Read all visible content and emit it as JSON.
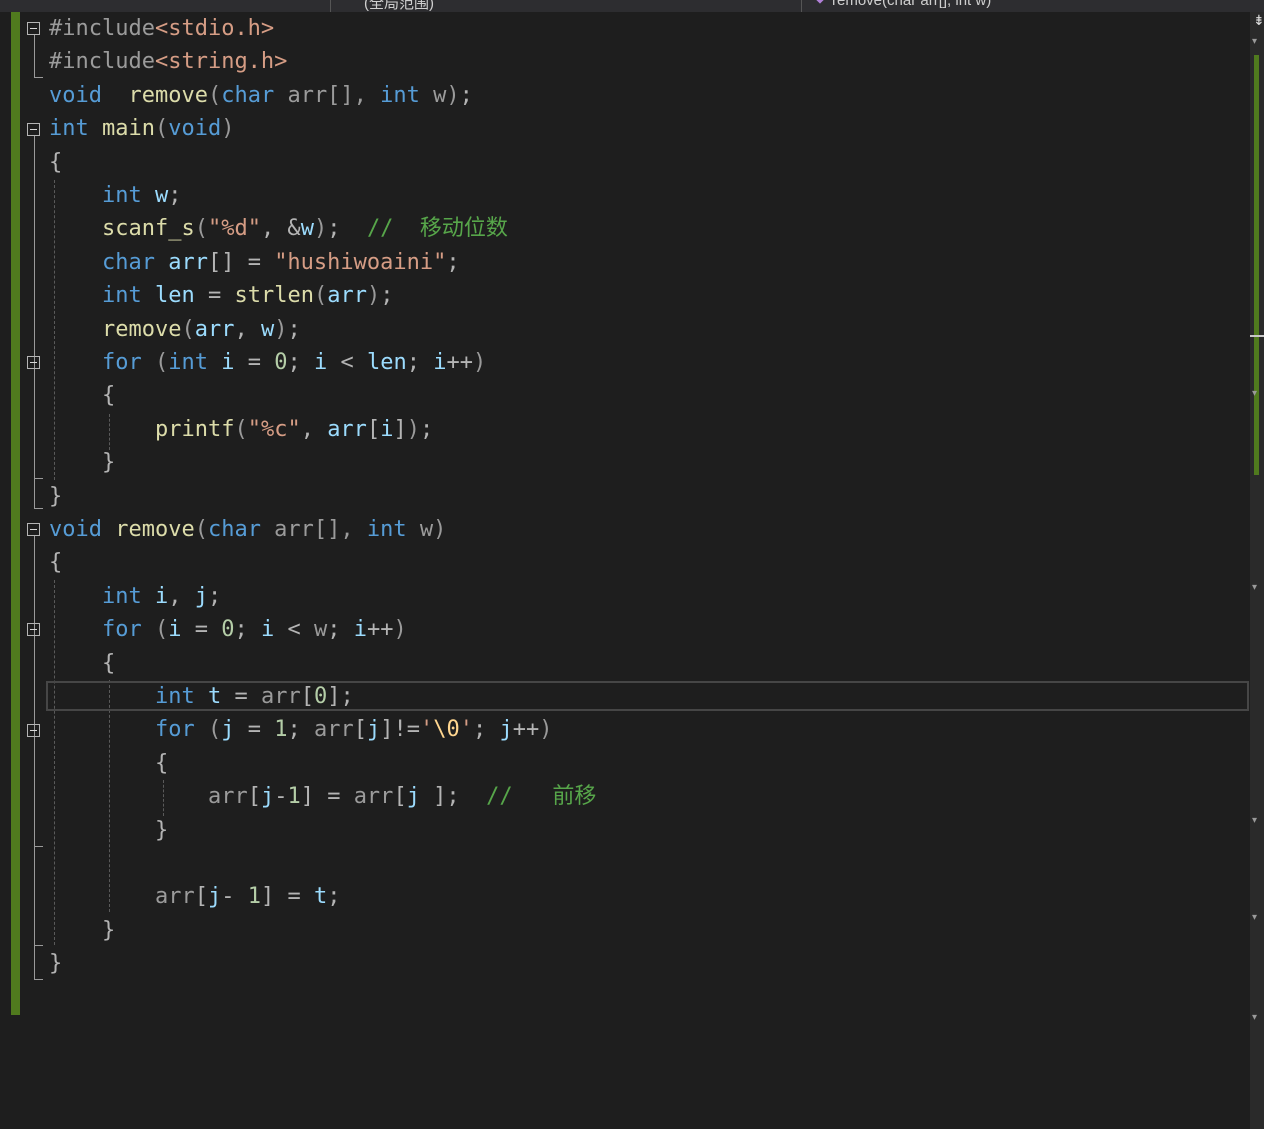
{
  "navbar": {
    "project_scope": "",
    "global_scope": "(全局范围)",
    "member": "remove(char arr[], int w)"
  },
  "lines": [
    [
      [
        "pp",
        "#include"
      ],
      [
        "str",
        "<stdio.h>"
      ]
    ],
    [
      [
        "pp",
        "#include"
      ],
      [
        "str",
        "<string.h>"
      ]
    ],
    [
      [
        "kw",
        "void"
      ],
      [
        "",
        "  "
      ],
      [
        "fn",
        "remove"
      ],
      [
        "par",
        "("
      ],
      [
        "kw",
        "char"
      ],
      [
        "",
        ""
      ],
      [
        "pp",
        " arr[], "
      ],
      [
        "kw",
        "int"
      ],
      [
        "pp",
        " w"
      ],
      [
        "par",
        ")"
      ],
      [
        "op",
        ";"
      ]
    ],
    [
      [
        "kw",
        "int"
      ],
      [
        "",
        ""
      ],
      [
        "fn",
        " main"
      ],
      [
        "par",
        "("
      ],
      [
        "kw",
        "void"
      ],
      [
        "par",
        ")"
      ]
    ],
    [
      [
        "op",
        "{"
      ]
    ],
    [
      [
        "",
        "    "
      ],
      [
        "kw",
        "int"
      ],
      [
        "var",
        " w"
      ],
      [
        "op",
        ";"
      ]
    ],
    [
      [
        "",
        "    "
      ],
      [
        "fn",
        "scanf_s"
      ],
      [
        "par",
        "("
      ],
      [
        "str",
        "\"%d\""
      ],
      [
        "op",
        ", &"
      ],
      [
        "var",
        "w"
      ],
      [
        "par",
        ")"
      ],
      [
        "op",
        ";  "
      ],
      [
        "cm",
        "//  移动位数"
      ]
    ],
    [
      [
        "",
        "    "
      ],
      [
        "kw",
        "char"
      ],
      [
        "var",
        " arr"
      ],
      [
        "op",
        "[] = "
      ],
      [
        "str",
        "\"hushiwoaini\""
      ],
      [
        "op",
        ";"
      ]
    ],
    [
      [
        "",
        "    "
      ],
      [
        "kw",
        "int"
      ],
      [
        "var",
        " len"
      ],
      [
        "op",
        " = "
      ],
      [
        "fn",
        "strlen"
      ],
      [
        "par",
        "("
      ],
      [
        "var",
        "arr"
      ],
      [
        "par",
        ")"
      ],
      [
        "op",
        ";"
      ]
    ],
    [
      [
        "",
        "    "
      ],
      [
        "fn",
        "remove"
      ],
      [
        "par",
        "("
      ],
      [
        "var",
        "arr"
      ],
      [
        "op",
        ", "
      ],
      [
        "var",
        "w"
      ],
      [
        "par",
        ")"
      ],
      [
        "op",
        ";"
      ]
    ],
    [
      [
        "",
        "    "
      ],
      [
        "kw",
        "for"
      ],
      [
        "par",
        " ("
      ],
      [
        "kw",
        "int"
      ],
      [
        "var",
        " i"
      ],
      [
        "op",
        " = "
      ],
      [
        "num",
        "0"
      ],
      [
        "op",
        "; "
      ],
      [
        "var",
        "i"
      ],
      [
        "op",
        " < "
      ],
      [
        "var",
        "len"
      ],
      [
        "op",
        "; "
      ],
      [
        "var",
        "i"
      ],
      [
        "op",
        "++"
      ],
      [
        "par",
        ")"
      ]
    ],
    [
      [
        "",
        "    "
      ],
      [
        "op",
        "{"
      ]
    ],
    [
      [
        "",
        "        "
      ],
      [
        "fn",
        "printf"
      ],
      [
        "par",
        "("
      ],
      [
        "str",
        "\"%c\""
      ],
      [
        "op",
        ", "
      ],
      [
        "var",
        "arr"
      ],
      [
        "op",
        "["
      ],
      [
        "var",
        "i"
      ],
      [
        "op",
        "]"
      ],
      [
        "par",
        ")"
      ],
      [
        "op",
        ";"
      ]
    ],
    [
      [
        "",
        "    "
      ],
      [
        "op",
        "}"
      ]
    ],
    [
      [
        "op",
        "}"
      ]
    ],
    [
      [
        "kw",
        "void"
      ],
      [
        "fn",
        " remove"
      ],
      [
        "par",
        "("
      ],
      [
        "kw",
        "char"
      ],
      [
        "pp",
        " arr[], "
      ],
      [
        "kw",
        "int"
      ],
      [
        "pp",
        " w"
      ],
      [
        "par",
        ")"
      ]
    ],
    [
      [
        "op",
        "{"
      ]
    ],
    [
      [
        "",
        "    "
      ],
      [
        "kw",
        "int"
      ],
      [
        "var",
        " i"
      ],
      [
        "op",
        ", "
      ],
      [
        "var",
        "j"
      ],
      [
        "op",
        ";"
      ]
    ],
    [
      [
        "",
        "    "
      ],
      [
        "kw",
        "for"
      ],
      [
        "par",
        " ("
      ],
      [
        "var",
        "i"
      ],
      [
        "op",
        " = "
      ],
      [
        "num",
        "0"
      ],
      [
        "op",
        "; "
      ],
      [
        "var",
        "i"
      ],
      [
        "op",
        " < "
      ],
      [
        "pp",
        "w"
      ],
      [
        "op",
        "; "
      ],
      [
        "var",
        "i"
      ],
      [
        "op",
        "++"
      ],
      [
        "par",
        ")"
      ]
    ],
    [
      [
        "",
        "    "
      ],
      [
        "op",
        "{"
      ]
    ],
    [
      [
        "",
        "        "
      ],
      [
        "kw",
        "int"
      ],
      [
        "var",
        " t"
      ],
      [
        "op",
        " = "
      ],
      [
        "pp",
        "arr"
      ],
      [
        "op",
        "["
      ],
      [
        "num",
        "0"
      ],
      [
        "op",
        "];"
      ]
    ],
    [
      [
        "",
        "        "
      ],
      [
        "kw",
        "for"
      ],
      [
        "par",
        " ("
      ],
      [
        "var",
        "j"
      ],
      [
        "op",
        " = "
      ],
      [
        "num",
        "1"
      ],
      [
        "op",
        "; "
      ],
      [
        "pp",
        "arr"
      ],
      [
        "op",
        "["
      ],
      [
        "var",
        "j"
      ],
      [
        "op",
        "]!="
      ],
      [
        "str",
        "'"
      ],
      [
        "esc",
        "\\0"
      ],
      [
        "str",
        "'"
      ],
      [
        "op",
        "; "
      ],
      [
        "var",
        "j"
      ],
      [
        "op",
        "++"
      ],
      [
        "par",
        ")"
      ]
    ],
    [
      [
        "",
        "        "
      ],
      [
        "op",
        "{"
      ]
    ],
    [
      [
        "",
        "            "
      ],
      [
        "pp",
        "arr"
      ],
      [
        "op",
        "["
      ],
      [
        "var",
        "j"
      ],
      [
        "op",
        "-"
      ],
      [
        "num",
        "1"
      ],
      [
        "op",
        "] = "
      ],
      [
        "pp",
        "arr"
      ],
      [
        "op",
        "["
      ],
      [
        "var",
        "j"
      ],
      [
        "op",
        " ];  "
      ],
      [
        "cm",
        "//   前移"
      ]
    ],
    [
      [
        "",
        "        "
      ],
      [
        "op",
        "}"
      ]
    ],
    [
      [
        "",
        ""
      ]
    ],
    [
      [
        "",
        "        "
      ],
      [
        "pp",
        "arr"
      ],
      [
        "op",
        "["
      ],
      [
        "var",
        "j"
      ],
      [
        "op",
        "- "
      ],
      [
        "num",
        "1"
      ],
      [
        "op",
        "] = "
      ],
      [
        "var",
        "t"
      ],
      [
        "op",
        ";"
      ]
    ],
    [
      [
        "",
        "    "
      ],
      [
        "op",
        "}"
      ]
    ],
    [
      [
        "op",
        "}"
      ]
    ]
  ],
  "colors": {
    "background": "#1e1e1e",
    "keyword": "#569cd6",
    "function": "#dcdcaa",
    "string": "#d69d85",
    "comment": "#57a64a",
    "change_bar": "#507a1e"
  }
}
